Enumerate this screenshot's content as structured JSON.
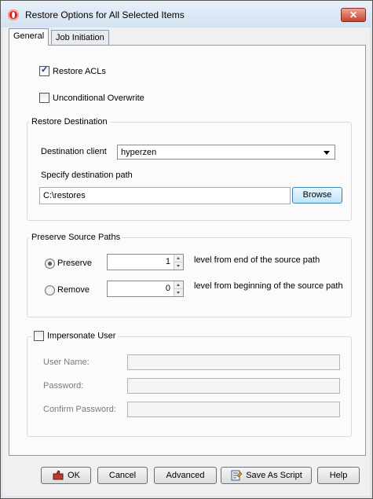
{
  "window": {
    "title": "Restore Options for All Selected Items",
    "close_glyph": "✕"
  },
  "tabs": [
    {
      "label": "General",
      "active": true
    },
    {
      "label": "Job Initiation",
      "active": false
    }
  ],
  "general": {
    "restore_acls": {
      "label": "Restore ACLs",
      "checked": true
    },
    "unconditional_overwrite": {
      "label": "Unconditional Overwrite",
      "checked": false
    },
    "restore_destination": {
      "title": "Restore Destination",
      "client_label": "Destination client",
      "client_value": "hyperzen",
      "path_label": "Specify destination path",
      "path_value": "C:\\restores",
      "browse_label": "Browse"
    },
    "preserve_source_paths": {
      "title": "Preserve Source Paths",
      "preserve": {
        "label": "Preserve",
        "selected": true,
        "value": "1",
        "desc": "level from end of the source path"
      },
      "remove": {
        "label": "Remove",
        "selected": false,
        "value": "0",
        "desc": "level from beginning of the source path"
      }
    },
    "impersonate": {
      "label": "Impersonate User",
      "checked": false,
      "user_name_label": "User Name:",
      "password_label": "Password:",
      "confirm_password_label": "Confirm Password:",
      "user_name_value": "",
      "password_value": "",
      "confirm_password_value": ""
    }
  },
  "buttons": {
    "ok": "OK",
    "cancel": "Cancel",
    "advanced": "Advanced",
    "save_as_script": "Save As Script",
    "help": "Help"
  },
  "icons": {
    "app": "app-logo-icon",
    "ok": "ok-hand-icon",
    "save_as_script": "script-icon"
  }
}
